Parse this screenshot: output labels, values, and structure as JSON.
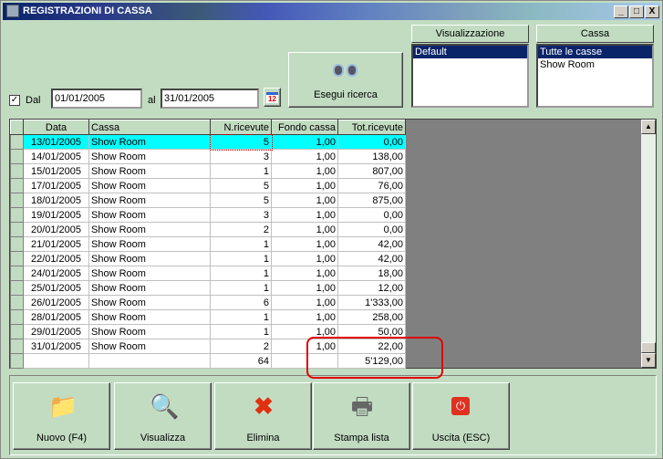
{
  "window": {
    "title": "REGISTRAZIONI DI CASSA",
    "min": "_",
    "max": "□",
    "close": "X"
  },
  "filter": {
    "dal_checked": "✓",
    "dal_label": "Dal",
    "from": "01/01/2005",
    "al_label": "al",
    "to": "31/01/2005",
    "calendar_day": "12",
    "search_label": "Esegui ricerca"
  },
  "visualizzazione": {
    "header": "Visualizzazione",
    "items": [
      "Default"
    ]
  },
  "cassa": {
    "header": "Cassa",
    "items": [
      "Tutte le casse",
      "Show Room"
    ]
  },
  "table": {
    "columns": [
      "Data",
      "Cassa",
      "N.ricevute",
      "Fondo cassa",
      "Tot.ricevute"
    ],
    "rows": [
      [
        "13/01/2005",
        "Show Room",
        "5",
        "1,00",
        "0,00"
      ],
      [
        "14/01/2005",
        "Show Room",
        "3",
        "1,00",
        "138,00"
      ],
      [
        "15/01/2005",
        "Show Room",
        "1",
        "1,00",
        "807,00"
      ],
      [
        "17/01/2005",
        "Show Room",
        "5",
        "1,00",
        "76,00"
      ],
      [
        "18/01/2005",
        "Show Room",
        "5",
        "1,00",
        "875,00"
      ],
      [
        "19/01/2005",
        "Show Room",
        "3",
        "1,00",
        "0,00"
      ],
      [
        "20/01/2005",
        "Show Room",
        "2",
        "1,00",
        "0,00"
      ],
      [
        "21/01/2005",
        "Show Room",
        "1",
        "1,00",
        "42,00"
      ],
      [
        "22/01/2005",
        "Show Room",
        "1",
        "1,00",
        "42,00"
      ],
      [
        "24/01/2005",
        "Show Room",
        "1",
        "1,00",
        "18,00"
      ],
      [
        "25/01/2005",
        "Show Room",
        "1",
        "1,00",
        "12,00"
      ],
      [
        "26/01/2005",
        "Show Room",
        "6",
        "1,00",
        "1'333,00"
      ],
      [
        "28/01/2005",
        "Show Room",
        "1",
        "1,00",
        "258,00"
      ],
      [
        "29/01/2005",
        "Show Room",
        "1",
        "1,00",
        "50,00"
      ],
      [
        "31/01/2005",
        "Show Room",
        "2",
        "1,00",
        "22,00"
      ]
    ],
    "totals": [
      "",
      "",
      "64",
      "",
      "5'129,00"
    ]
  },
  "buttons": [
    {
      "label": "Nuovo (F4)",
      "icon": "new-folder-icon"
    },
    {
      "label": "Visualizza",
      "icon": "view-icon"
    },
    {
      "label": "Elimina",
      "icon": "delete-x-icon"
    },
    {
      "label": "Stampa lista",
      "icon": "printer-icon"
    },
    {
      "label": "Uscita (ESC)",
      "icon": "exit-icon"
    }
  ],
  "colors": {
    "background": "#c2dcc2",
    "selected_row": "#00ffff",
    "annotation": "#e00000"
  }
}
